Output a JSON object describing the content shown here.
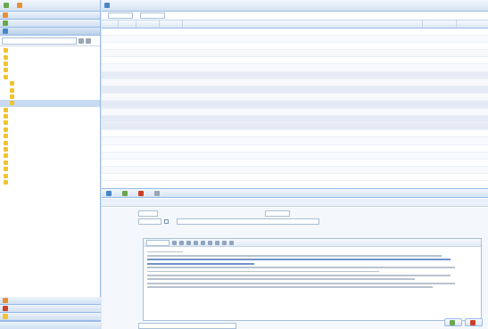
{
  "left": {
    "toolbar": [
      {
        "label": "",
        "icon": "add-icon"
      },
      {
        "label": "",
        "icon": "settings-icon"
      }
    ],
    "accordion_top": [
      {
        "label": "",
        "icon": "mail-icon"
      },
      {
        "label": "",
        "icon": "calendar-icon"
      },
      {
        "label": "",
        "icon": "folder-icon"
      }
    ],
    "search_placeholder": "",
    "tree": [
      {
        "label": "",
        "level": 1,
        "icon": "folder-icon"
      },
      {
        "label": "",
        "level": 1,
        "icon": "folder-icon"
      },
      {
        "label": "",
        "level": 1,
        "icon": "folder-icon"
      },
      {
        "label": "",
        "level": 1,
        "icon": "folder-icon"
      },
      {
        "label": "",
        "level": 1,
        "icon": "folder-open-icon"
      },
      {
        "label": "",
        "level": 2,
        "icon": "folder-icon"
      },
      {
        "label": "",
        "level": 2,
        "icon": "folder-icon"
      },
      {
        "label": "",
        "level": 2,
        "icon": "folder-icon"
      },
      {
        "label": "",
        "level": 2,
        "icon": "folder-icon",
        "selected": true
      },
      {
        "label": "",
        "level": 1,
        "icon": "folder-icon"
      },
      {
        "label": "",
        "level": 1,
        "icon": "folder-icon"
      },
      {
        "label": "",
        "level": 1,
        "icon": "folder-icon"
      },
      {
        "label": "",
        "level": 1,
        "icon": "folder-icon"
      },
      {
        "label": "",
        "level": 1,
        "icon": "folder-icon"
      },
      {
        "label": "",
        "level": 1,
        "icon": "folder-icon"
      },
      {
        "label": "",
        "level": 1,
        "icon": "folder-icon"
      },
      {
        "label": "",
        "level": 1,
        "icon": "folder-icon"
      },
      {
        "label": "",
        "level": 1,
        "icon": "folder-icon"
      },
      {
        "label": "",
        "level": 1,
        "icon": "folder-icon"
      },
      {
        "label": "",
        "level": 1,
        "icon": "folder-icon"
      },
      {
        "label": "",
        "level": 1,
        "icon": "folder-icon"
      }
    ],
    "accordion_bottom": [
      {
        "label": "",
        "icon": "contacts-icon"
      },
      {
        "label": "",
        "icon": "warning-icon"
      },
      {
        "label": "",
        "icon": "folder-icon"
      }
    ],
    "status_left": "",
    "status_right": ""
  },
  "grid": {
    "toolbar_label": "",
    "filter_labels": [
      "",
      ""
    ],
    "columns": [
      "",
      "",
      "",
      "",
      "",
      "",
      ""
    ],
    "rows": [
      [
        "",
        "",
        "",
        "",
        "",
        "",
        ""
      ],
      [
        "",
        "",
        "",
        "",
        "",
        "",
        ""
      ],
      [
        "",
        "",
        "",
        "",
        "",
        "",
        ""
      ],
      [
        "",
        "",
        "",
        "",
        "",
        "",
        ""
      ],
      [
        "",
        "",
        "",
        "",
        "",
        "",
        ""
      ],
      [
        "",
        "",
        "",
        "",
        "",
        "",
        ""
      ],
      [
        "",
        "",
        "",
        "",
        "",
        "",
        ""
      ],
      [
        "",
        "",
        "",
        "",
        "",
        "",
        ""
      ],
      [
        "",
        "",
        "",
        "",
        "",
        "",
        ""
      ],
      [
        "",
        "",
        "",
        "",
        "",
        "",
        ""
      ],
      [
        "",
        "",
        "",
        "",
        "",
        "",
        ""
      ],
      [
        "",
        "",
        "",
        "",
        "",
        "",
        ""
      ],
      [
        "",
        "",
        "",
        "",
        "",
        "",
        ""
      ],
      [
        "",
        "",
        "",
        "",
        "",
        "",
        ""
      ],
      [
        "",
        "",
        "",
        "",
        "",
        "",
        ""
      ],
      [
        "",
        "",
        "",
        "",
        "",
        "",
        ""
      ],
      [
        "",
        "",
        "",
        "",
        "",
        "",
        ""
      ],
      [
        "",
        "",
        "",
        "",
        "",
        "",
        ""
      ],
      [
        "",
        "",
        "",
        "",
        "",
        "",
        ""
      ],
      [
        "",
        "",
        "",
        "",
        "",
        "",
        ""
      ],
      [
        "",
        "",
        "",
        "",
        "",
        "",
        ""
      ]
    ]
  },
  "detail": {
    "toolbar": [
      {
        "label": "",
        "icon": "reply-icon"
      },
      {
        "label": "",
        "icon": "forward-icon"
      },
      {
        "label": "",
        "icon": "delete-icon"
      },
      {
        "label": "",
        "icon": "print-icon"
      }
    ],
    "tab_label": "",
    "fields": {
      "from_label": "",
      "to_label": "",
      "date_label": "",
      "date_value": "",
      "cc_label": "",
      "subject_label": "",
      "subject_value": "",
      "recipients_label": "",
      "recipients_value": "",
      "body_label": "",
      "font_select": "",
      "attach_label": "",
      "attach_value": ""
    },
    "buttons": [
      "",
      ""
    ]
  },
  "colors": {
    "accent": "#99bbe8",
    "header_bg": "#dfe8f6",
    "warn_text": "#cc4125"
  }
}
